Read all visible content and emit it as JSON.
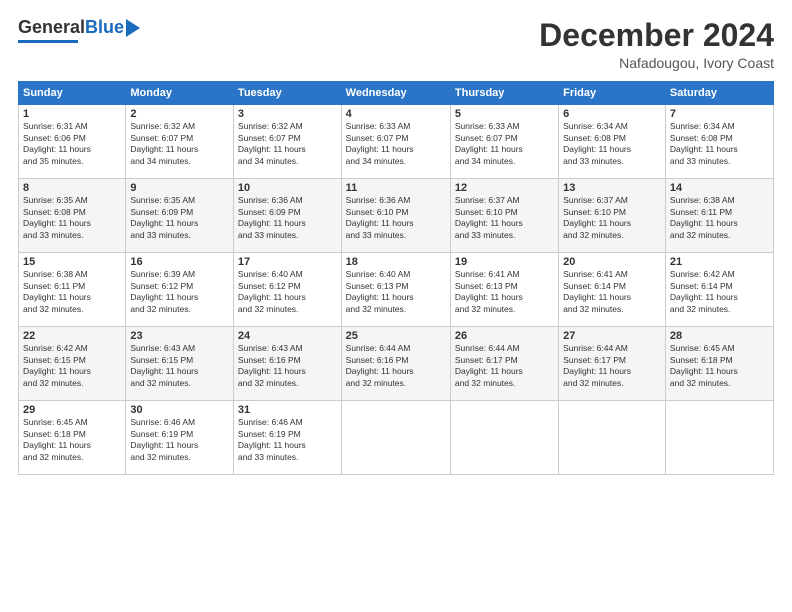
{
  "header": {
    "logo_general": "General",
    "logo_blue": "Blue",
    "month_title": "December 2024",
    "location": "Nafadougou, Ivory Coast"
  },
  "weekdays": [
    "Sunday",
    "Monday",
    "Tuesday",
    "Wednesday",
    "Thursday",
    "Friday",
    "Saturday"
  ],
  "weeks": [
    [
      {
        "day": "1",
        "info": "Sunrise: 6:31 AM\nSunset: 6:06 PM\nDaylight: 11 hours\nand 35 minutes."
      },
      {
        "day": "2",
        "info": "Sunrise: 6:32 AM\nSunset: 6:07 PM\nDaylight: 11 hours\nand 34 minutes."
      },
      {
        "day": "3",
        "info": "Sunrise: 6:32 AM\nSunset: 6:07 PM\nDaylight: 11 hours\nand 34 minutes."
      },
      {
        "day": "4",
        "info": "Sunrise: 6:33 AM\nSunset: 6:07 PM\nDaylight: 11 hours\nand 34 minutes."
      },
      {
        "day": "5",
        "info": "Sunrise: 6:33 AM\nSunset: 6:07 PM\nDaylight: 11 hours\nand 34 minutes."
      },
      {
        "day": "6",
        "info": "Sunrise: 6:34 AM\nSunset: 6:08 PM\nDaylight: 11 hours\nand 33 minutes."
      },
      {
        "day": "7",
        "info": "Sunrise: 6:34 AM\nSunset: 6:08 PM\nDaylight: 11 hours\nand 33 minutes."
      }
    ],
    [
      {
        "day": "8",
        "info": "Sunrise: 6:35 AM\nSunset: 6:08 PM\nDaylight: 11 hours\nand 33 minutes."
      },
      {
        "day": "9",
        "info": "Sunrise: 6:35 AM\nSunset: 6:09 PM\nDaylight: 11 hours\nand 33 minutes."
      },
      {
        "day": "10",
        "info": "Sunrise: 6:36 AM\nSunset: 6:09 PM\nDaylight: 11 hours\nand 33 minutes."
      },
      {
        "day": "11",
        "info": "Sunrise: 6:36 AM\nSunset: 6:10 PM\nDaylight: 11 hours\nand 33 minutes."
      },
      {
        "day": "12",
        "info": "Sunrise: 6:37 AM\nSunset: 6:10 PM\nDaylight: 11 hours\nand 33 minutes."
      },
      {
        "day": "13",
        "info": "Sunrise: 6:37 AM\nSunset: 6:10 PM\nDaylight: 11 hours\nand 32 minutes."
      },
      {
        "day": "14",
        "info": "Sunrise: 6:38 AM\nSunset: 6:11 PM\nDaylight: 11 hours\nand 32 minutes."
      }
    ],
    [
      {
        "day": "15",
        "info": "Sunrise: 6:38 AM\nSunset: 6:11 PM\nDaylight: 11 hours\nand 32 minutes."
      },
      {
        "day": "16",
        "info": "Sunrise: 6:39 AM\nSunset: 6:12 PM\nDaylight: 11 hours\nand 32 minutes."
      },
      {
        "day": "17",
        "info": "Sunrise: 6:40 AM\nSunset: 6:12 PM\nDaylight: 11 hours\nand 32 minutes."
      },
      {
        "day": "18",
        "info": "Sunrise: 6:40 AM\nSunset: 6:13 PM\nDaylight: 11 hours\nand 32 minutes."
      },
      {
        "day": "19",
        "info": "Sunrise: 6:41 AM\nSunset: 6:13 PM\nDaylight: 11 hours\nand 32 minutes."
      },
      {
        "day": "20",
        "info": "Sunrise: 6:41 AM\nSunset: 6:14 PM\nDaylight: 11 hours\nand 32 minutes."
      },
      {
        "day": "21",
        "info": "Sunrise: 6:42 AM\nSunset: 6:14 PM\nDaylight: 11 hours\nand 32 minutes."
      }
    ],
    [
      {
        "day": "22",
        "info": "Sunrise: 6:42 AM\nSunset: 6:15 PM\nDaylight: 11 hours\nand 32 minutes."
      },
      {
        "day": "23",
        "info": "Sunrise: 6:43 AM\nSunset: 6:15 PM\nDaylight: 11 hours\nand 32 minutes."
      },
      {
        "day": "24",
        "info": "Sunrise: 6:43 AM\nSunset: 6:16 PM\nDaylight: 11 hours\nand 32 minutes."
      },
      {
        "day": "25",
        "info": "Sunrise: 6:44 AM\nSunset: 6:16 PM\nDaylight: 11 hours\nand 32 minutes."
      },
      {
        "day": "26",
        "info": "Sunrise: 6:44 AM\nSunset: 6:17 PM\nDaylight: 11 hours\nand 32 minutes."
      },
      {
        "day": "27",
        "info": "Sunrise: 6:44 AM\nSunset: 6:17 PM\nDaylight: 11 hours\nand 32 minutes."
      },
      {
        "day": "28",
        "info": "Sunrise: 6:45 AM\nSunset: 6:18 PM\nDaylight: 11 hours\nand 32 minutes."
      }
    ],
    [
      {
        "day": "29",
        "info": "Sunrise: 6:45 AM\nSunset: 6:18 PM\nDaylight: 11 hours\nand 32 minutes."
      },
      {
        "day": "30",
        "info": "Sunrise: 6:46 AM\nSunset: 6:19 PM\nDaylight: 11 hours\nand 32 minutes."
      },
      {
        "day": "31",
        "info": "Sunrise: 6:46 AM\nSunset: 6:19 PM\nDaylight: 11 hours\nand 33 minutes."
      },
      null,
      null,
      null,
      null
    ]
  ]
}
